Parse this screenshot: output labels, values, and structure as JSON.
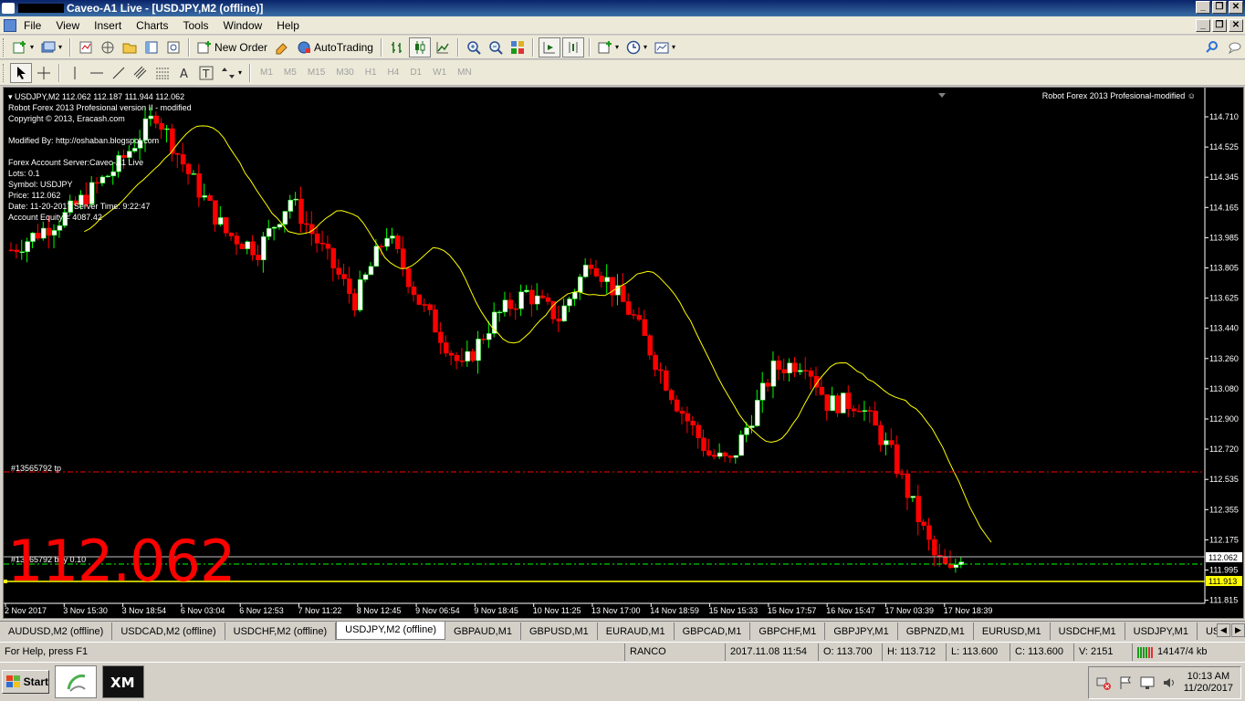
{
  "window": {
    "title": "Caveo-A1 Live - [USDJPY,M2 (offline)]",
    "controls": [
      "_",
      "❐",
      "✕"
    ],
    "inner_controls": [
      "_",
      "❐",
      "✕"
    ]
  },
  "menu": [
    "File",
    "View",
    "Insert",
    "Charts",
    "Tools",
    "Window",
    "Help"
  ],
  "toolbar": {
    "new_order": "New Order",
    "autotrading": "AutoTrading"
  },
  "periods": [
    "M1",
    "M5",
    "M15",
    "M30",
    "H1",
    "H4",
    "D1",
    "W1",
    "MN"
  ],
  "chart": {
    "header": "USDJPY,M2  112.062 112.187 111.944 112.062",
    "info_lines": [
      "Robot Forex 2013 Profesional version II - modified",
      "Copyright © 2013, Eracash.com",
      "",
      "Modified By: http://oshaban.blogspot.com",
      "",
      "Forex Account Server:Caveo-A1 Live",
      "Lots:  0.1",
      "Symbol: USDJPY",
      "Price:  112.062",
      "Date: 11-20-2017  Server Time: 9:22:47",
      "Account Equity = 4087.42"
    ],
    "robot_label": "Robot Forex 2013 Profesional-modified ☺",
    "big_price": "112.062",
    "tp_label": "#13565792 tp",
    "buy_label": "#13565792 buy 0.10",
    "y_axis": [
      "114.710",
      "114.525",
      "114.345",
      "114.165",
      "113.985",
      "113.805",
      "113.625",
      "113.440",
      "113.260",
      "113.080",
      "112.900",
      "112.720",
      "112.535",
      "112.355",
      "112.175",
      "111.995",
      "111.815"
    ],
    "price_tag": "112.062",
    "tp_tag": "111.913",
    "x_axis": [
      "2 Nov 2017",
      "3 Nov 15:30",
      "3 Nov 18:54",
      "6 Nov 03:04",
      "6 Nov 12:53",
      "7 Nov 11:22",
      "8 Nov 12:45",
      "9 Nov 06:54",
      "9 Nov 18:45",
      "10 Nov 11:25",
      "13 Nov 17:00",
      "14 Nov 18:59",
      "15 Nov 15:33",
      "15 Nov 17:57",
      "16 Nov 15:47",
      "17 Nov 03:39",
      "17 Nov 18:39"
    ],
    "colors": {
      "background": "#000000",
      "bear": "#ff0000",
      "bull": "#ffffff",
      "wick": "#00ff00",
      "ma": "#ffff00",
      "tp_line": "#ff0000",
      "buy_line": "#00ff00",
      "bid_line": "#c0c0c0",
      "yellow_line": "#ffff00"
    }
  },
  "tabs": [
    "AUDUSD,M2 (offline)",
    "USDCAD,M2 (offline)",
    "USDCHF,M2 (offline)",
    "USDJPY,M2 (offline)",
    "GBPAUD,M1",
    "GBPUSD,M1",
    "EURAUD,M1",
    "GBPCAD,M1",
    "GBPCHF,M1",
    "GBPJPY,M1",
    "GBPNZD,M1",
    "EURUSD,M1",
    "USDCHF,M1",
    "USDJPY,M1",
    "USDCA"
  ],
  "status": {
    "help": "For Help, press F1",
    "profile": "RANCO",
    "datetime": "2017.11.08 11:54",
    "open": "O: 113.700",
    "high": "H: 113.712",
    "low": "L: 113.600",
    "close": "C: 113.600",
    "volume": "V: 2151",
    "traffic": "14147/4 kb"
  },
  "taskbar": {
    "start": "Start",
    "time": "10:13 AM",
    "date": "11/20/2017"
  }
}
